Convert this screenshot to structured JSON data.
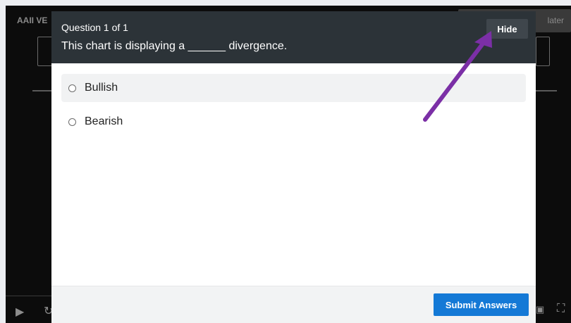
{
  "player": {
    "title": "AAII VE",
    "later_label": "later"
  },
  "quiz": {
    "counter": "Question 1 of 1",
    "question": "This chart is displaying a ______ divergence.",
    "hide_label": "Hide",
    "options": [
      {
        "label": "Bullish",
        "selected": false
      },
      {
        "label": "Bearish",
        "selected": false
      }
    ],
    "submit_label": "Submit Answers"
  },
  "annotation": {
    "arrow_color": "#7b2fa6"
  },
  "colors": {
    "header_bg": "#2c3338",
    "submit_bg": "#1479d6"
  },
  "icons": [
    "play-icon",
    "replay-icon",
    "fullscreen-icon",
    "radio-icon"
  ]
}
